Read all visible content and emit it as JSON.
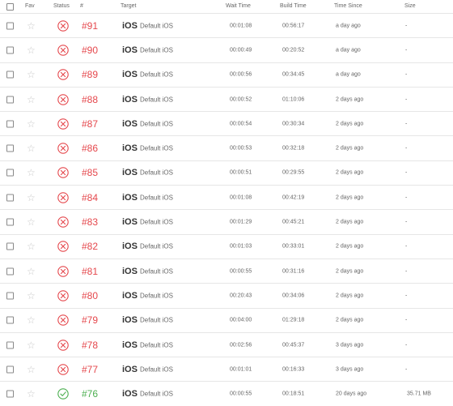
{
  "columns": {
    "fav": "Fav",
    "status": "Status",
    "number": "#",
    "target": "Target",
    "wait_time": "Wait Time",
    "build_time": "Build Time",
    "time_since": "Time Since",
    "size": "Size"
  },
  "colors": {
    "failed": "#e5484d",
    "success": "#4caf50",
    "star": "#c8c8c8"
  },
  "icons": {
    "failed": "x-circle-icon",
    "success": "check-circle-icon",
    "fav": "star-outline-icon"
  },
  "rows": [
    {
      "number": "#91",
      "status": "failed",
      "platform": "iOS",
      "target": "Default iOS",
      "wait": "00:01:08",
      "build": "00:56:17",
      "since": "a day ago",
      "size": "-"
    },
    {
      "number": "#90",
      "status": "failed",
      "platform": "iOS",
      "target": "Default iOS",
      "wait": "00:00:49",
      "build": "00:20:52",
      "since": "a day ago",
      "size": "-"
    },
    {
      "number": "#89",
      "status": "failed",
      "platform": "iOS",
      "target": "Default iOS",
      "wait": "00:00:56",
      "build": "00:34:45",
      "since": "a day ago",
      "size": "-"
    },
    {
      "number": "#88",
      "status": "failed",
      "platform": "iOS",
      "target": "Default iOS",
      "wait": "00:00:52",
      "build": "01:10:06",
      "since": "2 days ago",
      "size": "-"
    },
    {
      "number": "#87",
      "status": "failed",
      "platform": "iOS",
      "target": "Default iOS",
      "wait": "00:00:54",
      "build": "00:30:34",
      "since": "2 days ago",
      "size": "-"
    },
    {
      "number": "#86",
      "status": "failed",
      "platform": "iOS",
      "target": "Default iOS",
      "wait": "00:00:53",
      "build": "00:32:18",
      "since": "2 days ago",
      "size": "-"
    },
    {
      "number": "#85",
      "status": "failed",
      "platform": "iOS",
      "target": "Default iOS",
      "wait": "00:00:51",
      "build": "00:29:55",
      "since": "2 days ago",
      "size": "-"
    },
    {
      "number": "#84",
      "status": "failed",
      "platform": "iOS",
      "target": "Default iOS",
      "wait": "00:01:08",
      "build": "00:42:19",
      "since": "2 days ago",
      "size": "-"
    },
    {
      "number": "#83",
      "status": "failed",
      "platform": "iOS",
      "target": "Default iOS",
      "wait": "00:01:29",
      "build": "00:45:21",
      "since": "2 days ago",
      "size": "-"
    },
    {
      "number": "#82",
      "status": "failed",
      "platform": "iOS",
      "target": "Default iOS",
      "wait": "00:01:03",
      "build": "00:33:01",
      "since": "2 days ago",
      "size": "-"
    },
    {
      "number": "#81",
      "status": "failed",
      "platform": "iOS",
      "target": "Default iOS",
      "wait": "00:00:55",
      "build": "00:31:16",
      "since": "2 days ago",
      "size": "-"
    },
    {
      "number": "#80",
      "status": "failed",
      "platform": "iOS",
      "target": "Default iOS",
      "wait": "00:20:43",
      "build": "00:34:06",
      "since": "2 days ago",
      "size": "-"
    },
    {
      "number": "#79",
      "status": "failed",
      "platform": "iOS",
      "target": "Default iOS",
      "wait": "00:04:00",
      "build": "01:29:18",
      "since": "2 days ago",
      "size": "-"
    },
    {
      "number": "#78",
      "status": "failed",
      "platform": "iOS",
      "target": "Default iOS",
      "wait": "00:02:56",
      "build": "00:45:37",
      "since": "3 days ago",
      "size": "-"
    },
    {
      "number": "#77",
      "status": "failed",
      "platform": "iOS",
      "target": "Default iOS",
      "wait": "00:01:01",
      "build": "00:16:33",
      "since": "3 days ago",
      "size": "-"
    },
    {
      "number": "#76",
      "status": "success",
      "platform": "iOS",
      "target": "Default iOS",
      "wait": "00:00:55",
      "build": "00:18:51",
      "since": "20 days ago",
      "size": "35.71 MB"
    }
  ]
}
